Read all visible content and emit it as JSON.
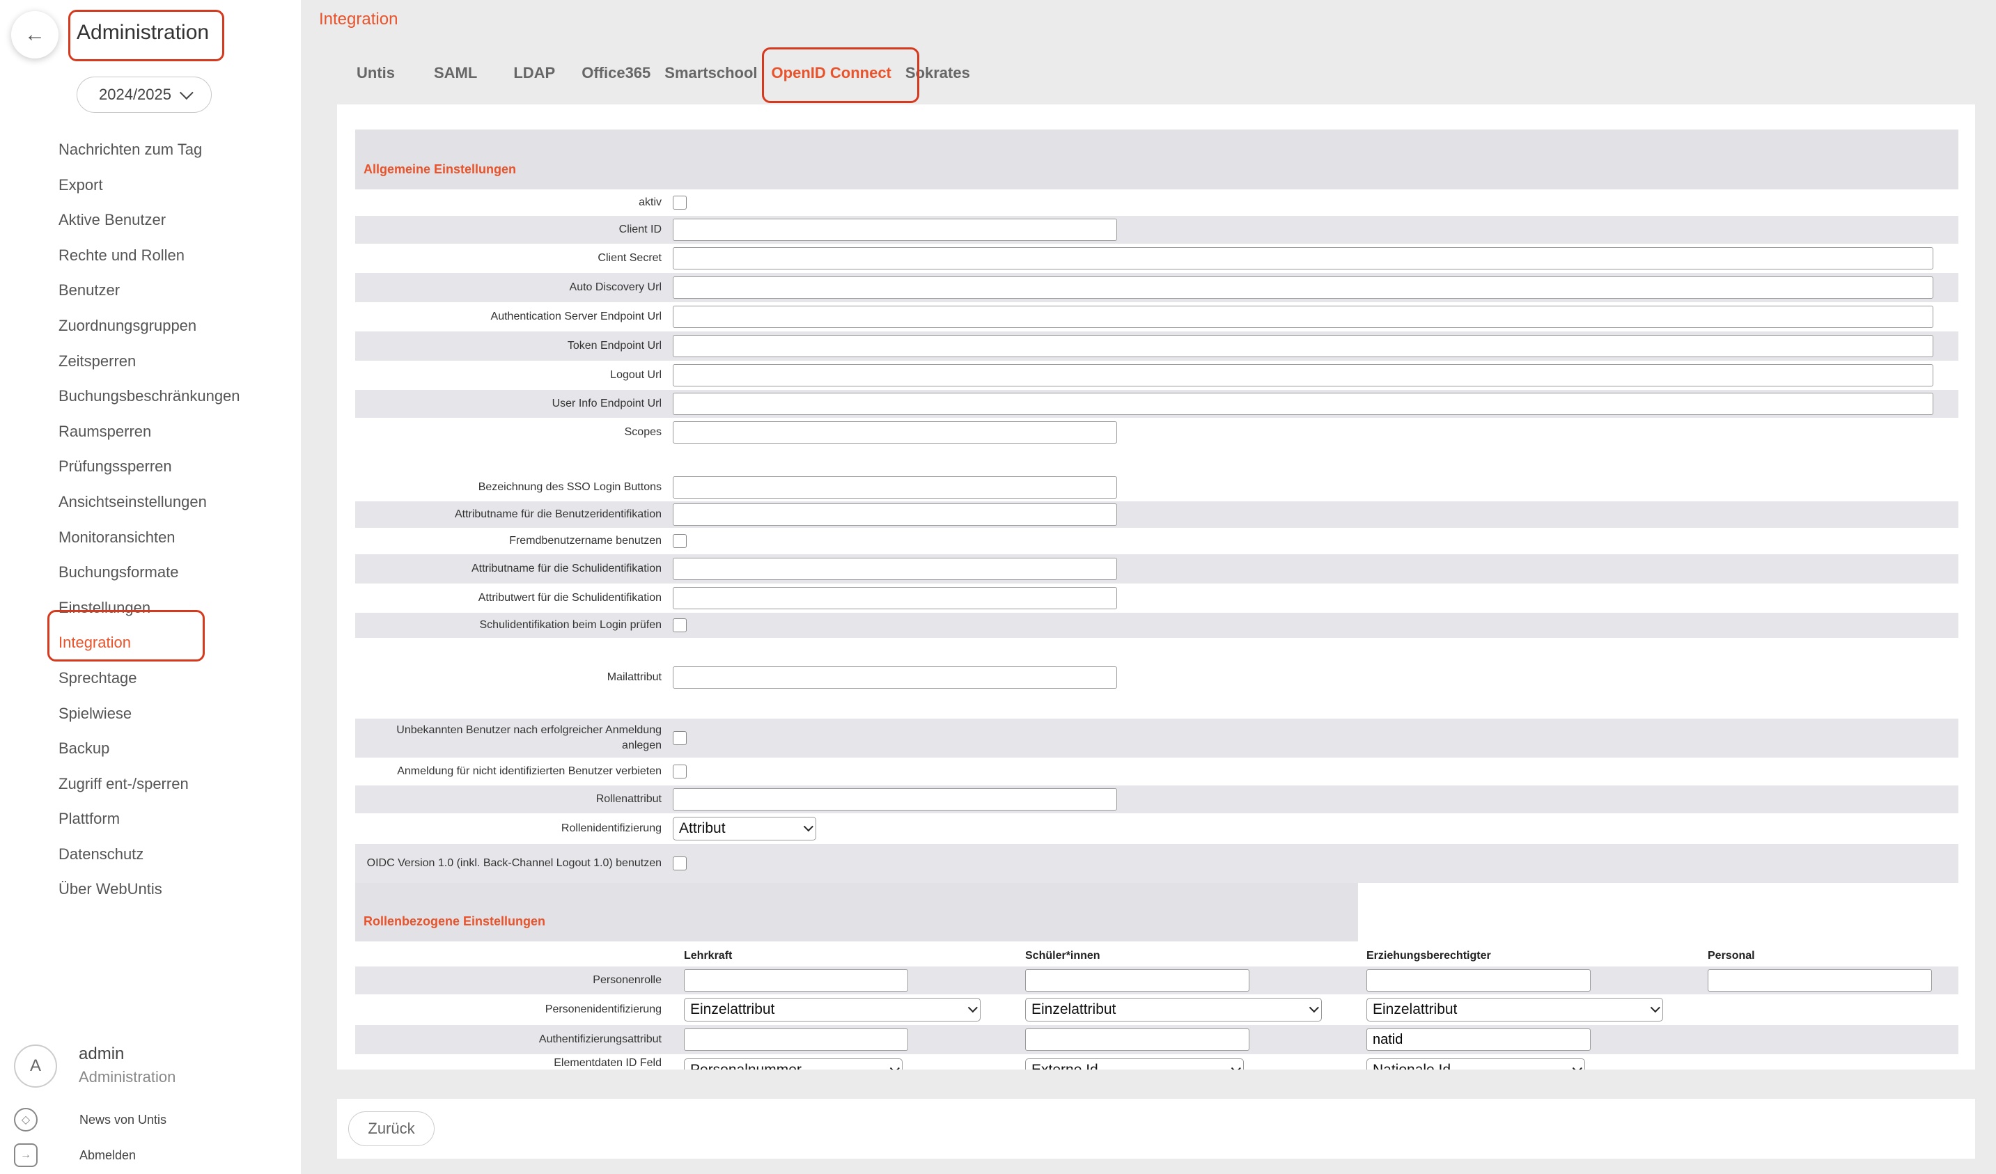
{
  "sidebar": {
    "back_icon": "arrow-left-icon",
    "title": "Administration",
    "year": "2024/2025",
    "items": [
      {
        "label": "Nachrichten zum Tag"
      },
      {
        "label": "Export"
      },
      {
        "label": "Aktive Benutzer"
      },
      {
        "label": "Rechte und Rollen"
      },
      {
        "label": "Benutzer"
      },
      {
        "label": "Zuordnungsgruppen"
      },
      {
        "label": "Zeitsperren"
      },
      {
        "label": "Buchungsbeschränkungen"
      },
      {
        "label": "Raumsperren"
      },
      {
        "label": "Prüfungssperren"
      },
      {
        "label": "Ansichtseinstellungen"
      },
      {
        "label": "Monitoransichten"
      },
      {
        "label": "Buchungsformate"
      },
      {
        "label": "Einstellungen"
      },
      {
        "label": "Integration",
        "active": true
      },
      {
        "label": "Sprechtage"
      },
      {
        "label": "Spielwiese"
      },
      {
        "label": "Backup"
      },
      {
        "label": "Zugriff ent-/sperren"
      },
      {
        "label": "Plattform"
      },
      {
        "label": "Datenschutz"
      },
      {
        "label": "Über WebUntis"
      }
    ],
    "user": {
      "initial": "A",
      "name": "admin",
      "role": "Administration"
    },
    "news_label": "News von Untis",
    "logout_label": "Abmelden"
  },
  "main": {
    "title": "Integration",
    "tabs": [
      "Untis",
      "SAML",
      "LDAP",
      "Office365",
      "Smartschool",
      "OpenID Connect",
      "Sokrates"
    ],
    "active_tab": "OpenID Connect",
    "general": {
      "heading": "Allgemeine Einstellungen",
      "aktiv": "aktiv",
      "client_id": "Client ID",
      "client_secret": "Client Secret",
      "auto_discovery": "Auto Discovery Url",
      "auth_endpoint": "Authentication Server Endpoint Url",
      "token_endpoint": "Token Endpoint Url",
      "logout_url": "Logout Url",
      "userinfo_endpoint": "User Info Endpoint Url",
      "scopes": "Scopes",
      "sso_button": "Bezeichnung des SSO Login Buttons",
      "user_attr": "Attributname für die Benutzeridentifikation",
      "foreign_user": "Fremdbenutzername benutzen",
      "school_attr_name": "Attributname für die Schulidentifikation",
      "school_attr_value": "Attributwert für die Schulidentifikation",
      "school_check": "Schulidentifikation beim Login prüfen",
      "mail_attr": "Mailattribut",
      "create_unknown": "Unbekannten Benutzer nach erfolgreicher Anmeldung anlegen",
      "deny_unidentified": "Anmeldung für nicht identifizierten Benutzer verbieten",
      "role_attr": "Rollenattribut",
      "role_ident": "Rollenidentifizierung",
      "role_ident_value": "Attribut",
      "oidc_version": "OIDC Version 1.0 (inkl. Back-Channel Logout 1.0) benutzen"
    },
    "roles": {
      "heading": "Rollenbezogene Einstellungen",
      "columns": [
        "Lehrkraft",
        "Schüler*innen",
        "Erziehungsberechtigter",
        "Personal"
      ],
      "person_role": "Personenrolle",
      "person_ident": "Personenidentifizierung",
      "person_ident_values": [
        "Einzelattribut",
        "Einzelattribut",
        "Einzelattribut"
      ],
      "auth_attr": "Authentifizierungsattribut",
      "auth_attr_values": [
        "",
        "",
        "natid"
      ],
      "element_id": "Elementdaten ID Feld",
      "element_id_values": [
        "Personalnummer",
        "Externe Id",
        "Nationale Id"
      ]
    },
    "back_button": "Zurück"
  },
  "colors": {
    "accent": "#e8532b",
    "highlight": "#d63a1e",
    "background": "#ebebec",
    "row_shade": "#e6e6ea"
  }
}
